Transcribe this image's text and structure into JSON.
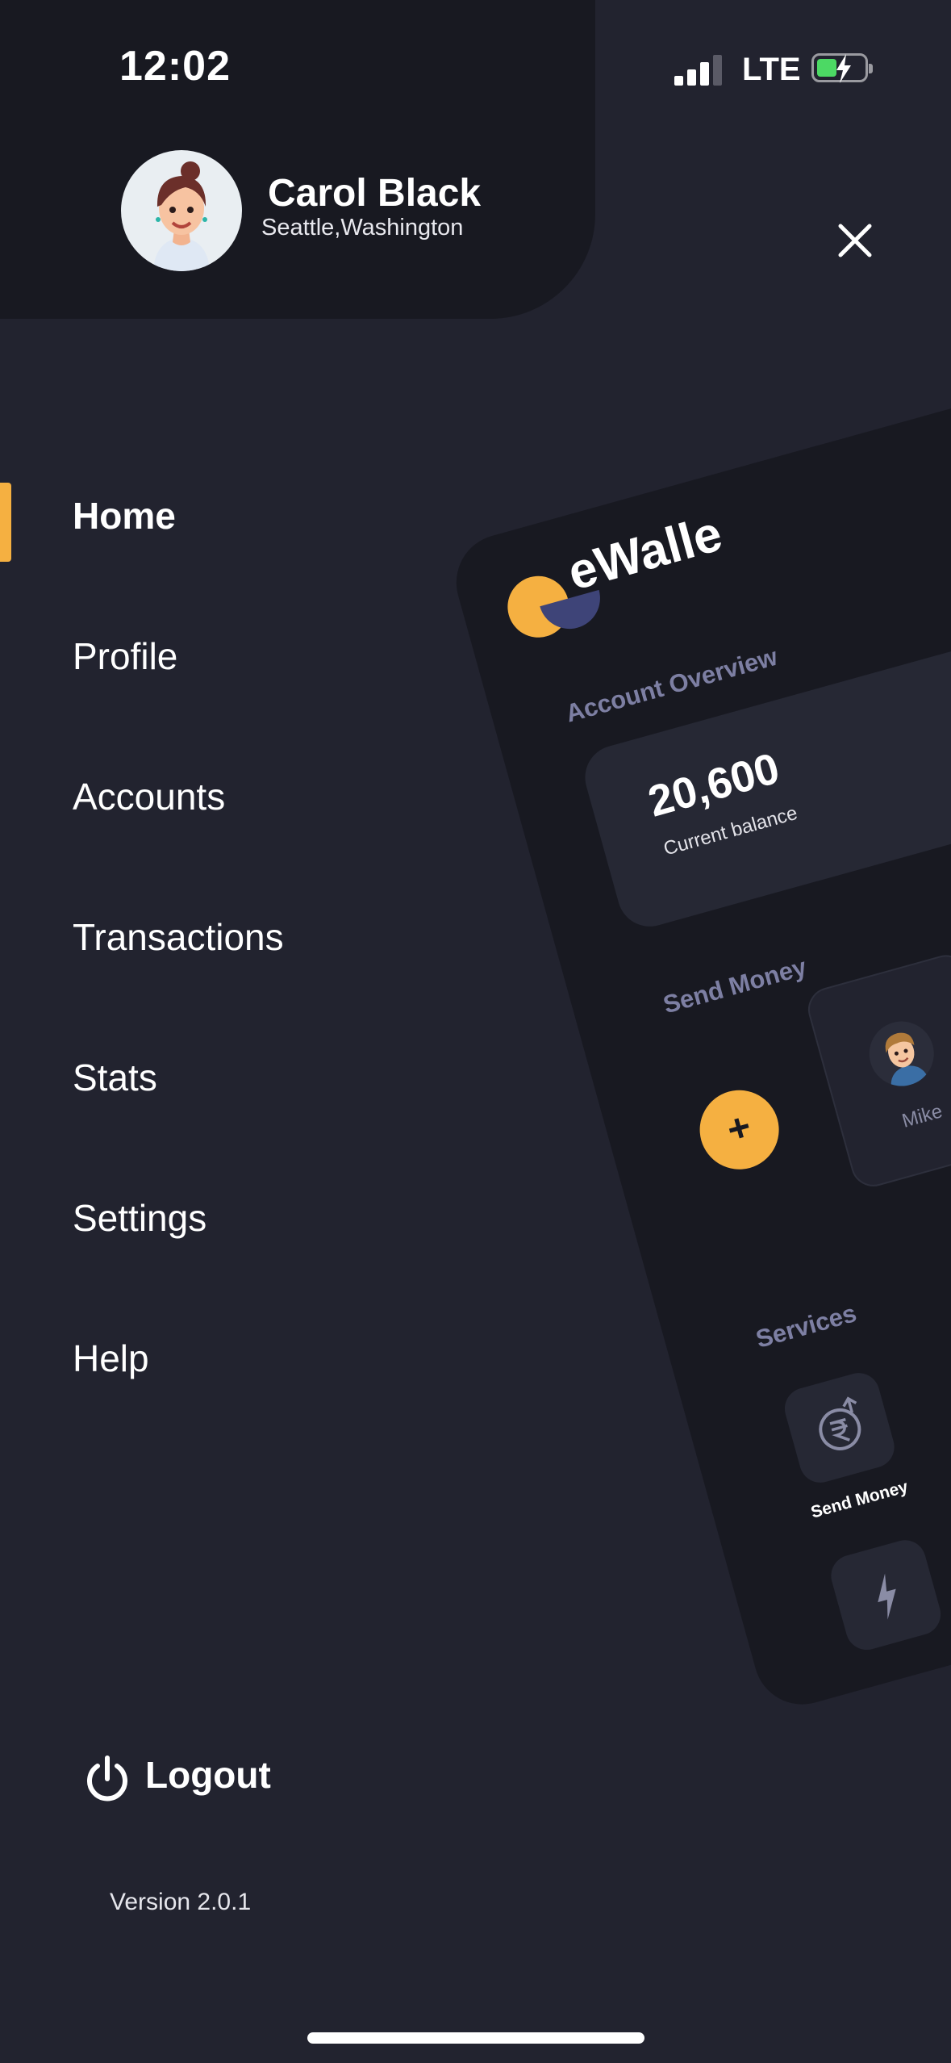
{
  "status_bar": {
    "time": "12:02",
    "network": "LTE"
  },
  "user": {
    "name": "Carol Black",
    "location": "Seattle,Washington"
  },
  "menu": {
    "items": [
      {
        "label": "Home",
        "active": true
      },
      {
        "label": "Profile",
        "active": false
      },
      {
        "label": "Accounts",
        "active": false
      },
      {
        "label": "Transactions",
        "active": false
      },
      {
        "label": "Stats",
        "active": false
      },
      {
        "label": "Settings",
        "active": false
      },
      {
        "label": "Help",
        "active": false
      }
    ]
  },
  "logout_label": "Logout",
  "version": "Version 2.0.1",
  "preview": {
    "brand": "eWalle",
    "account_overview": "Account Overview",
    "balance": "20,600",
    "balance_label": "Current balance",
    "send_money_title": "Send Money",
    "add_symbol": "+",
    "contacts": [
      {
        "name": "Mike"
      }
    ],
    "services_title": "Services",
    "services": [
      {
        "label": "Send Money"
      }
    ]
  },
  "colors": {
    "background": "#22232f",
    "panel": "#181921",
    "accent": "#f5b041",
    "muted": "#7d7fa3"
  }
}
